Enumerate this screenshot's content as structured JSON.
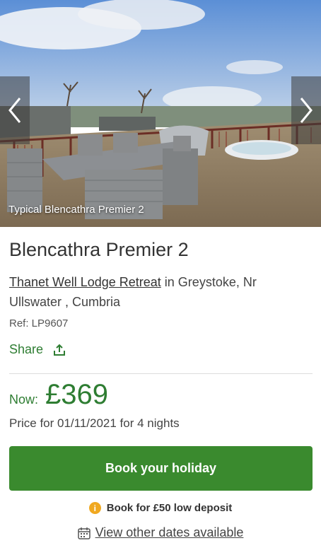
{
  "gallery": {
    "caption": "Typical Blencathra Premier 2",
    "prev_icon": "chevron-left-icon",
    "next_icon": "chevron-right-icon"
  },
  "property": {
    "title": "Blencathra Premier 2",
    "park_link": "Thanet Well Lodge Retreat",
    "location_text": " in Greystoke, Nr Ullswater , Cumbria",
    "ref": "Ref: LP9607"
  },
  "share": {
    "label": "Share",
    "icon": "share-icon"
  },
  "pricing": {
    "now_label": "Now:",
    "price": "£369",
    "note": "Price for 01/11/2021 for 4 nights"
  },
  "actions": {
    "book_label": "Book your holiday",
    "deposit_text": "Book for £50 low deposit",
    "dates_link": "View other dates available"
  },
  "colors": {
    "accent_green": "#3a8a2e",
    "text_green": "#2e7d32",
    "info_orange": "#f0a820"
  }
}
